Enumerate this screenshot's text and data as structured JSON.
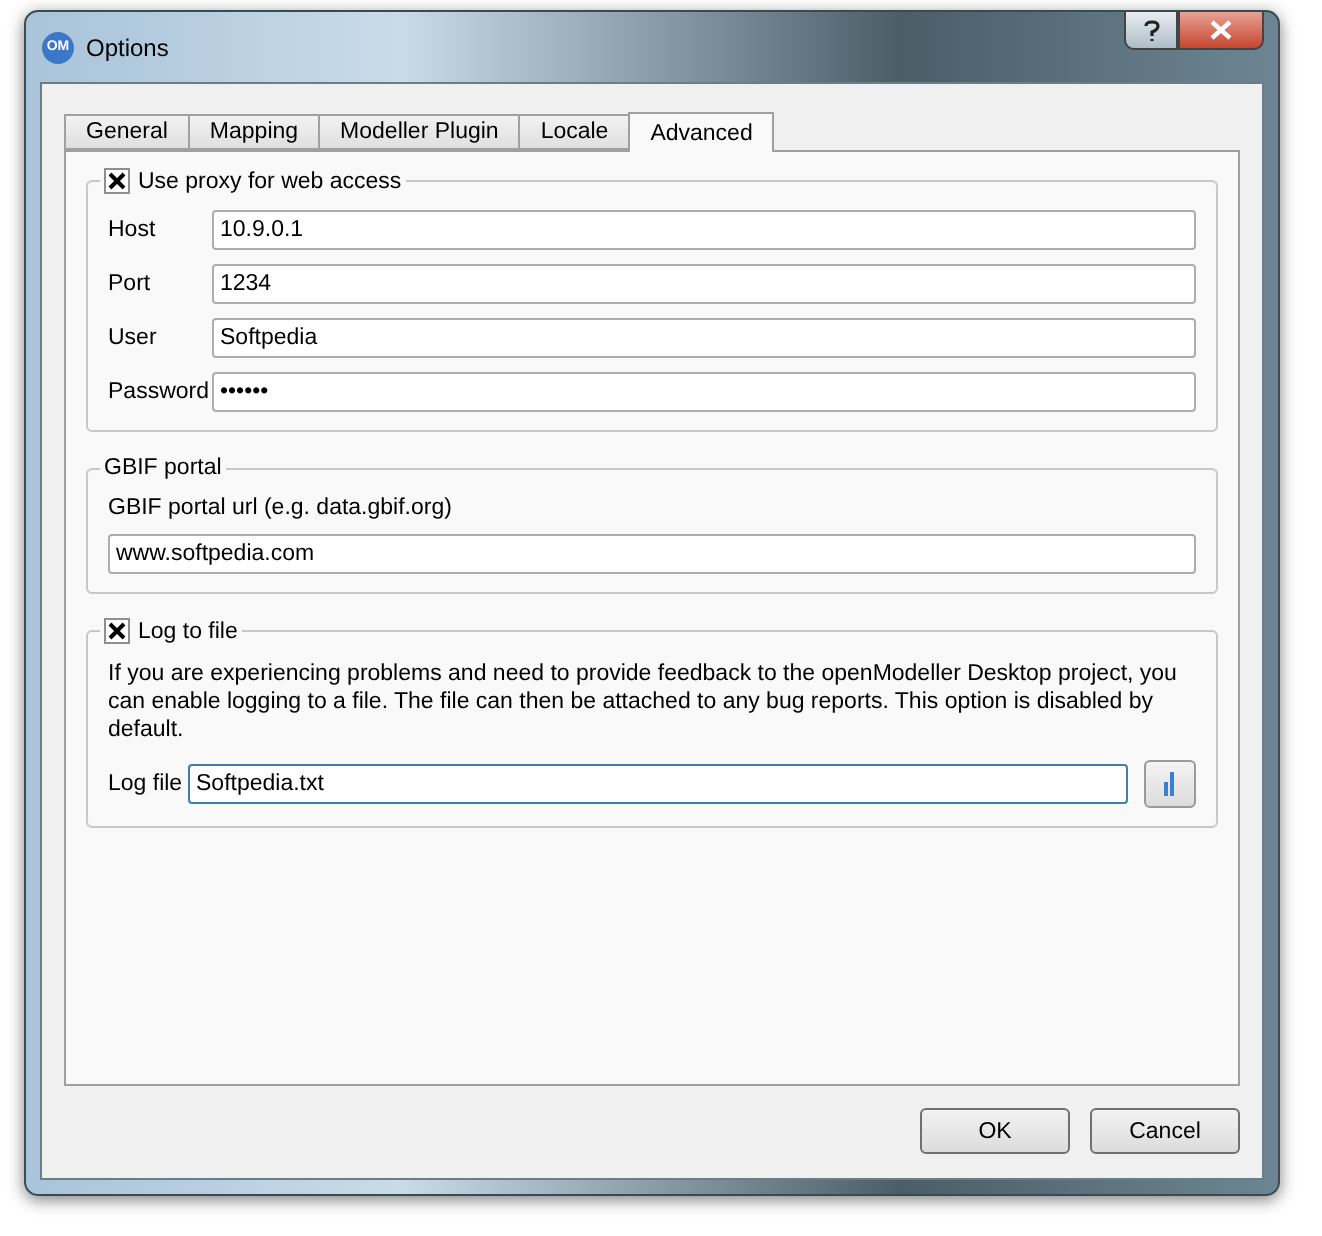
{
  "window": {
    "app_icon": "OM",
    "title": "Options"
  },
  "tabs": [
    {
      "label": "General",
      "selected": false
    },
    {
      "label": "Mapping",
      "selected": false
    },
    {
      "label": "Modeller Plugin",
      "selected": false
    },
    {
      "label": "Locale",
      "selected": false
    },
    {
      "label": "Advanced",
      "selected": true
    }
  ],
  "proxy": {
    "label": "Use proxy for web access",
    "checked": true,
    "fields": [
      {
        "label": "Host",
        "value": "10.9.0.1"
      },
      {
        "label": "Port",
        "value": "1234"
      },
      {
        "label": "User",
        "value": "Softpedia"
      },
      {
        "label": "Password",
        "value": "••••••"
      }
    ]
  },
  "gbif": {
    "title": "GBIF portal",
    "label": "GBIF portal url (e.g. data.gbif.org)",
    "value": "www.softpedia.com"
  },
  "log": {
    "label": "Log to file",
    "checked": true,
    "description": "If you are experiencing problems and need to provide feedback to the openModeller Desktop project, you can enable logging to a file. The file can then be attached to any bug reports. This option is disabled by default.",
    "field_label": "Log file",
    "value": "Softpedia.txt"
  },
  "buttons": [
    "OK",
    "Cancel"
  ]
}
